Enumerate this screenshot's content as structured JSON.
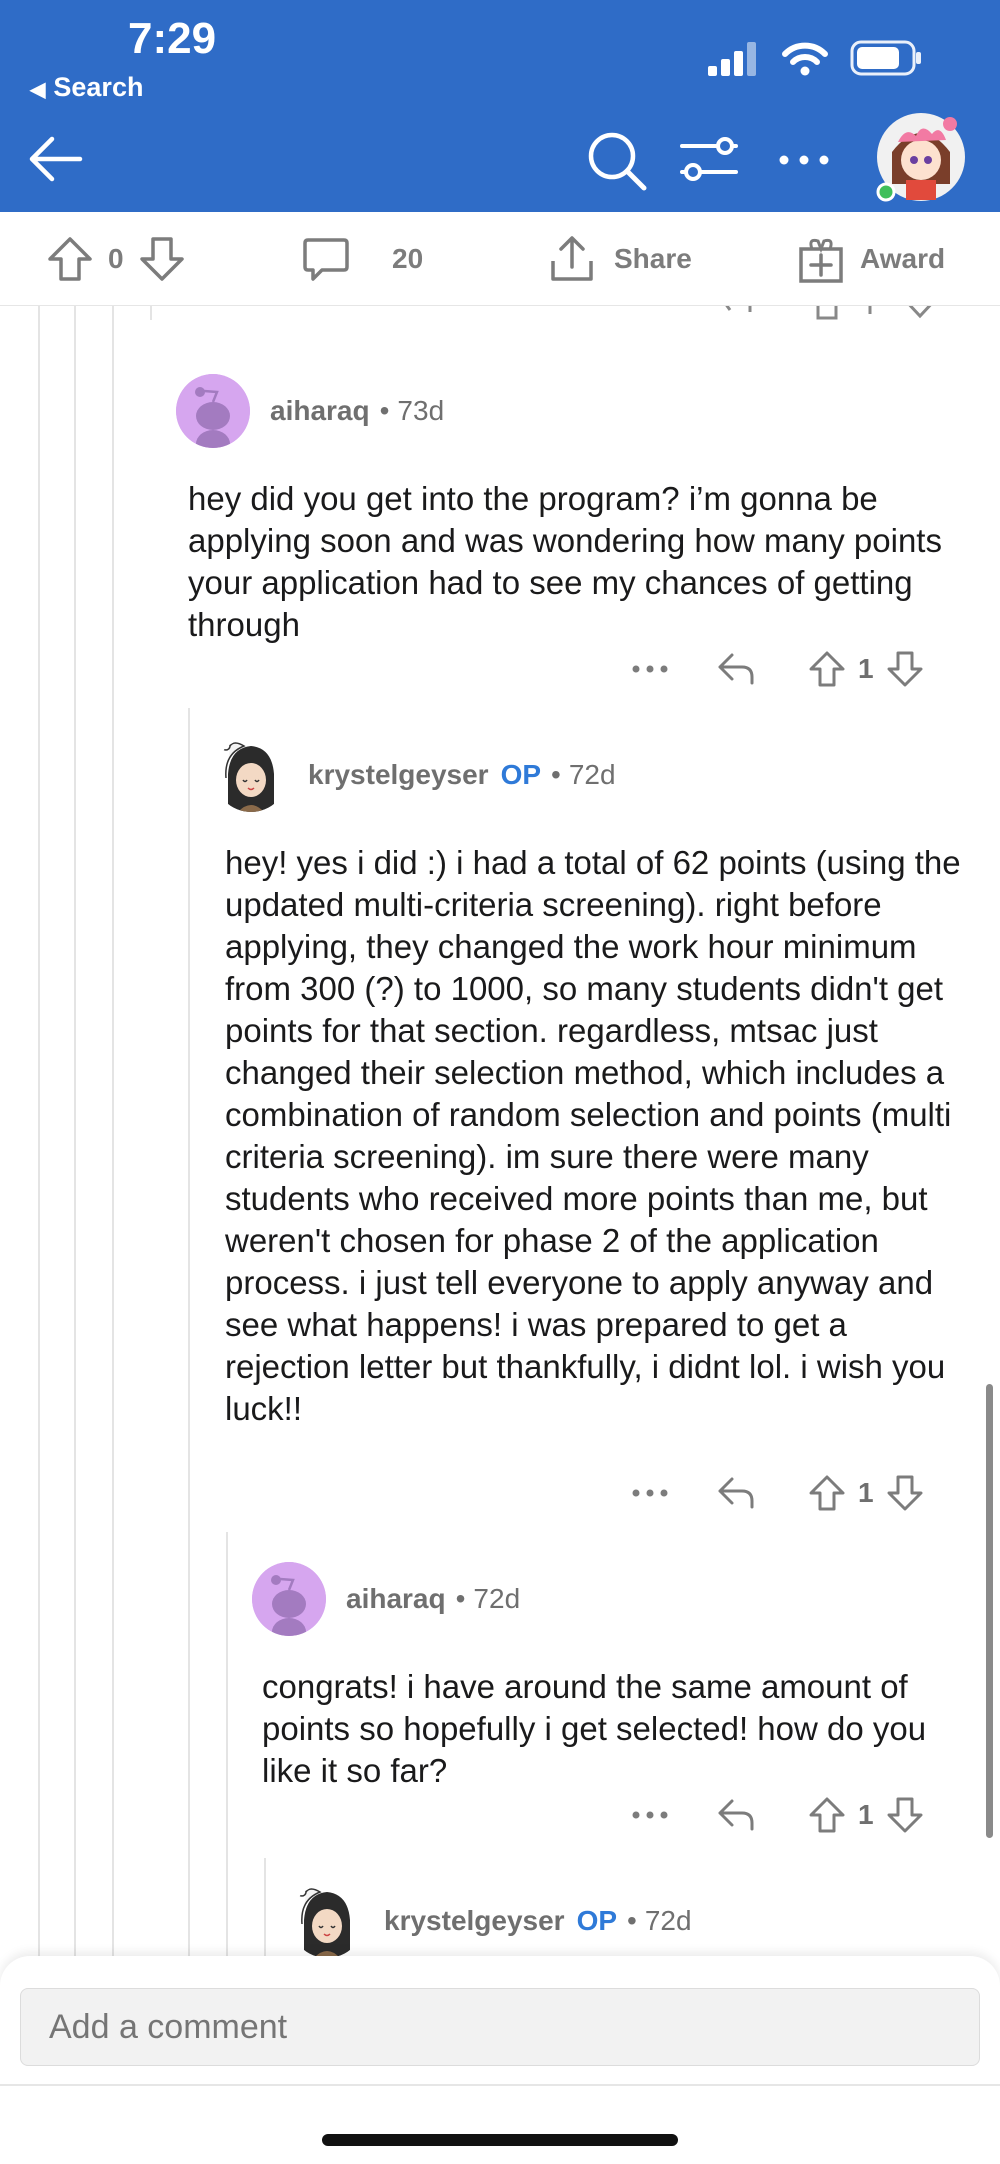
{
  "status_bar": {
    "time": "7:29",
    "back_label": "Search"
  },
  "action_bar": {
    "upvotes": "0",
    "comments": "20",
    "share_label": "Share",
    "award_label": "Award"
  },
  "comments": [
    {
      "username": "aiharaq",
      "op": "",
      "age": "73d",
      "body": "hey did you get into the program? i’m gonna be applying soon and was wondering how many points your application had to see my chances of getting through",
      "votes": "1"
    },
    {
      "username": "krystelgeyser",
      "op": "OP",
      "age": "72d",
      "body": "hey! yes i did :) i had a total of 62 points (using the updated multi-criteria screening). right before applying, they changed the work hour minimum from 300 (?) to 1000, so many students didn't get points for that section. regardless, mtsac just changed their selection method, which includes a combination of random selection and points (multi criteria screening). im sure there were many students who received more points than me, but weren't chosen for phase 2 of the application process. i just tell everyone to apply anyway and see what happens! i was prepared to get a rejection letter but thankfully, i didnt lol. i wish you luck!!",
      "votes": "1"
    },
    {
      "username": "aiharaq",
      "op": "",
      "age": "72d",
      "body": "congrats! i have around the same amount of points so hopefully i get selected! how do you like it so far?",
      "votes": "1"
    },
    {
      "username": "krystelgeyser",
      "op": "OP",
      "age": "72d",
      "body": "",
      "votes": ""
    }
  ],
  "composer": {
    "placeholder": "Add a comment"
  },
  "colors": {
    "header": "#2f6cc7",
    "op": "#2f7ad8",
    "avatar_purple": "#d6a6ef"
  }
}
